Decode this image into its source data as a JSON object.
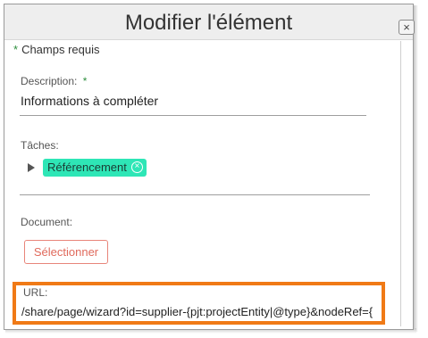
{
  "dialog": {
    "title": "Modifier l'élément",
    "close_label": "×"
  },
  "form": {
    "required_marker": "*",
    "required_note": "Champs requis",
    "description": {
      "label": "Description:",
      "required_marker": "*",
      "value": "Informations à compléter"
    },
    "tasks": {
      "label": "Tâches:",
      "tags": [
        "Référencement"
      ]
    },
    "document": {
      "label": "Document:",
      "select_button": "Sélectionner"
    },
    "url": {
      "label": "URL:",
      "value": "/share/page/wizard?id=supplier-{pjt:projectEntity|@type}&nodeRef={"
    }
  },
  "colors": {
    "tag_bg": "#2ee6b6",
    "select_button": "#e06a5c",
    "highlight_border": "#f07a16",
    "required_star": "#2f8f3f"
  }
}
